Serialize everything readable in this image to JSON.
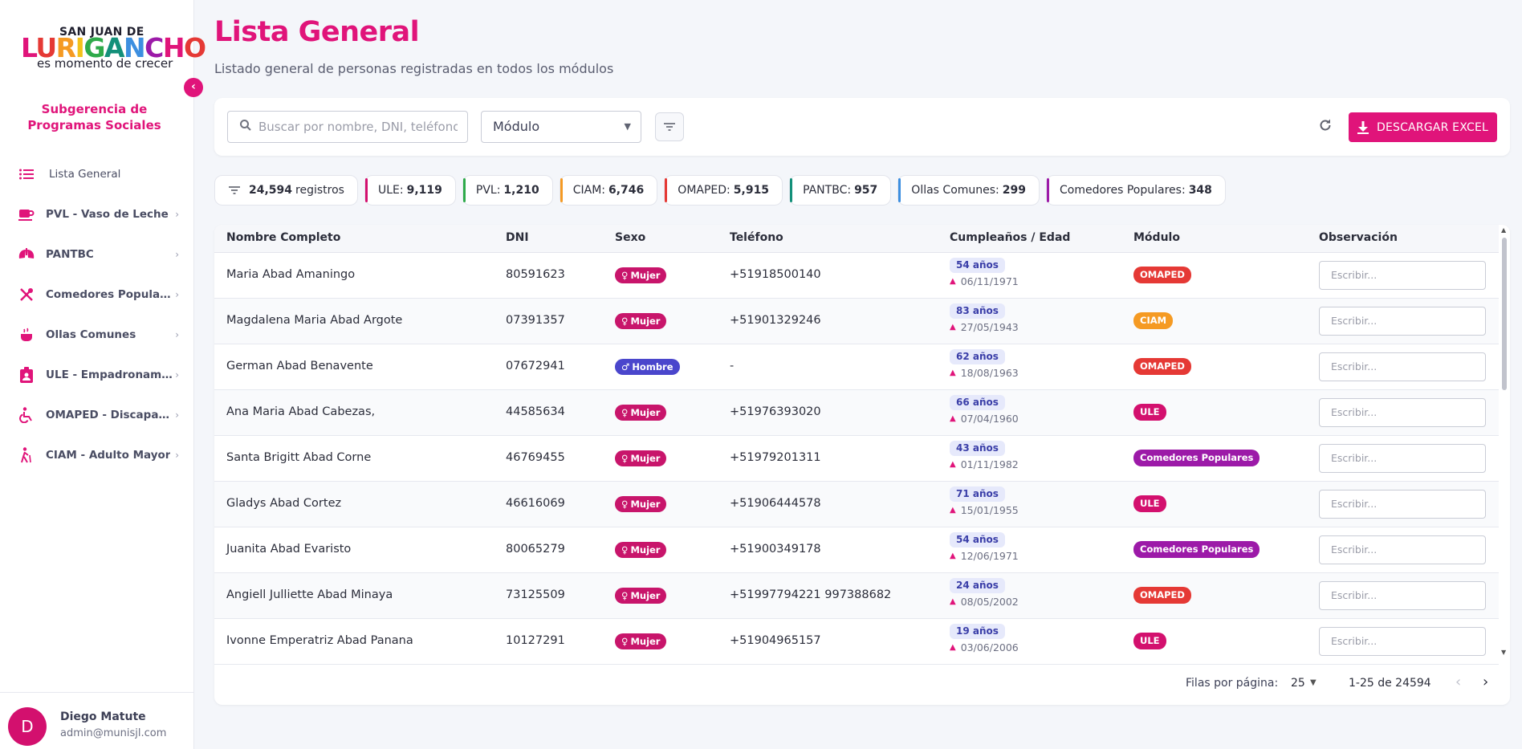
{
  "sidebar": {
    "logo": {
      "top": "SAN JUAN DE",
      "big": "LURIGANCHO",
      "sub": "es momento de crecer"
    },
    "org": "Subgerencia de Programas Sociales",
    "items": [
      {
        "label": "Lista General",
        "icon": "list-icon"
      },
      {
        "label": "PVL - Vaso de Leche",
        "icon": "cup-icon"
      },
      {
        "label": "PANTBC",
        "icon": "lungs-icon"
      },
      {
        "label": "Comedores Populares",
        "icon": "utensils-icon"
      },
      {
        "label": "Ollas Comunes",
        "icon": "pot-icon"
      },
      {
        "label": "ULE - Empadronamiento",
        "icon": "id-card-icon"
      },
      {
        "label": "OMAPED - Discapacidad",
        "icon": "wheelchair-icon"
      },
      {
        "label": "CIAM - Adulto Mayor",
        "icon": "elderly-icon"
      }
    ],
    "user": {
      "initial": "D",
      "name": "Diego Matute",
      "email": "admin@munisjl.com"
    }
  },
  "header": {
    "title": "Lista General",
    "subtitle": "Listado general de personas registradas en todos los módulos"
  },
  "toolbar": {
    "search_placeholder": "Buscar por nombre, DNI, teléfono",
    "module_label": "Módulo",
    "excel_label": "DESCARGAR EXCEL"
  },
  "stats": {
    "total_value": "24,594",
    "total_label": "registros",
    "modules": [
      {
        "label": "ULE:",
        "value": "9,119",
        "color": "#d3106e"
      },
      {
        "label": "PVL:",
        "value": "1,210",
        "color": "#2eaa4a"
      },
      {
        "label": "CIAM:",
        "value": "6,746",
        "color": "#f59a23"
      },
      {
        "label": "OMAPED:",
        "value": "5,915",
        "color": "#e53935"
      },
      {
        "label": "PANTBC:",
        "value": "957",
        "color": "#13907a"
      },
      {
        "label": "Ollas Comunes:",
        "value": "299",
        "color": "#3d8fe0"
      },
      {
        "label": "Comedores Populares:",
        "value": "348",
        "color": "#9c1aa8"
      }
    ]
  },
  "table": {
    "columns": [
      "Nombre Completo",
      "DNI",
      "Sexo",
      "Teléfono",
      "Cumpleaños / Edad",
      "Módulo",
      "Observación"
    ],
    "obs_placeholder": "Escribir...",
    "rows": [
      {
        "name": "Maria Abad Amaningo",
        "dni": "80591623",
        "sex": "Mujer",
        "phone": "+51918500140",
        "age": "54 años",
        "bday": "06/11/1971",
        "module": "OMAPED",
        "module_color": "#e53935"
      },
      {
        "name": "Magdalena Maria Abad Argote",
        "dni": "07391357",
        "sex": "Mujer",
        "phone": "+51901329246",
        "age": "83 años",
        "bday": "27/05/1943",
        "module": "CIAM",
        "module_color": "#f59a23"
      },
      {
        "name": "German Abad Benavente",
        "dni": "07672941",
        "sex": "Hombre",
        "phone": "-",
        "age": "62 años",
        "bday": "18/08/1963",
        "module": "OMAPED",
        "module_color": "#e53935"
      },
      {
        "name": "Ana Maria Abad Cabezas,",
        "dni": "44585634",
        "sex": "Mujer",
        "phone": "+51976393020",
        "age": "66 años",
        "bday": "07/04/1960",
        "module": "ULE",
        "module_color": "#d3106e"
      },
      {
        "name": "Santa Brigitt Abad Corne",
        "dni": "46769455",
        "sex": "Mujer",
        "phone": "+51979201311",
        "age": "43 años",
        "bday": "01/11/1982",
        "module": "Comedores Populares",
        "module_color": "#9c1aa8"
      },
      {
        "name": "Gladys Abad Cortez",
        "dni": "46616069",
        "sex": "Mujer",
        "phone": "+51906444578",
        "age": "71 años",
        "bday": "15/01/1955",
        "module": "ULE",
        "module_color": "#d3106e"
      },
      {
        "name": "Juanita Abad Evaristo",
        "dni": "80065279",
        "sex": "Mujer",
        "phone": "+51900349178",
        "age": "54 años",
        "bday": "12/06/1971",
        "module": "Comedores Populares",
        "module_color": "#9c1aa8"
      },
      {
        "name": "Angiell Julliette Abad Minaya",
        "dni": "73125509",
        "sex": "Mujer",
        "phone": "+51997794221 997388682",
        "age": "24 años",
        "bday": "08/05/2002",
        "module": "OMAPED",
        "module_color": "#e53935"
      },
      {
        "name": "Ivonne Emperatriz Abad Panana",
        "dni": "10127291",
        "sex": "Mujer",
        "phone": "+51904965157",
        "age": "19 años",
        "bday": "03/06/2006",
        "module": "ULE",
        "module_color": "#d3106e"
      }
    ]
  },
  "pagination": {
    "rows_per_page_label": "Filas por página:",
    "rows_per_page": "25",
    "range": "1-25 de 24594"
  },
  "colors": {
    "accent": "#e0147a",
    "female": "#c8156b",
    "male": "#4a46cc"
  }
}
